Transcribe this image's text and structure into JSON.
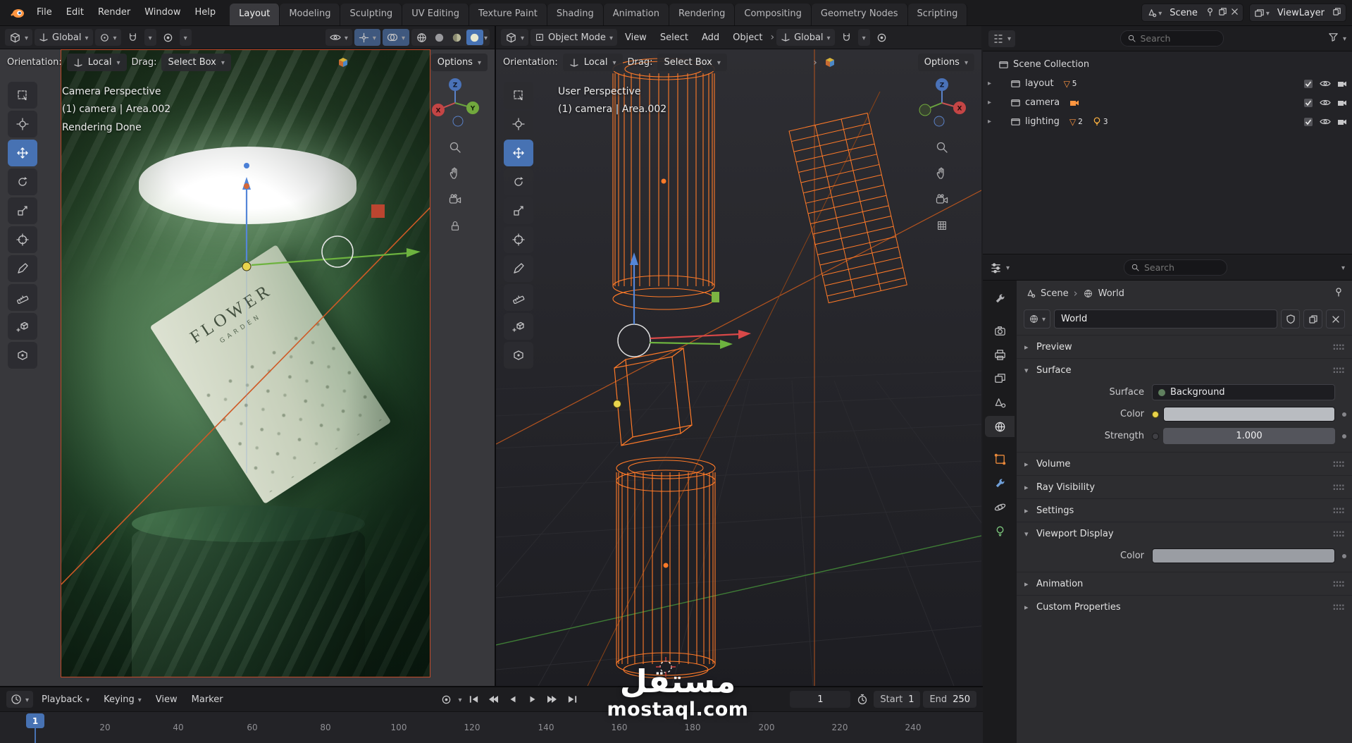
{
  "colors": {
    "accent_blue": "#4772b3",
    "wire_orange": "#ff7a28",
    "render_border": "#c44b2a"
  },
  "topbar": {
    "menus": [
      "File",
      "Edit",
      "Render",
      "Window",
      "Help"
    ],
    "tabs": [
      "Layout",
      "Modeling",
      "Sculpting",
      "UV Editing",
      "Texture Paint",
      "Shading",
      "Animation",
      "Rendering",
      "Compositing",
      "Geometry Nodes",
      "Scripting"
    ],
    "scene_label": "Scene",
    "viewlayer_label": "ViewLayer"
  },
  "vp_left": {
    "transform_orientation": "Global",
    "orientation_label": "Orientation:",
    "orientation_value": "Local",
    "drag_label": "Drag:",
    "drag_value": "Select Box",
    "options_label": "Options",
    "overlay_line1": "Camera Perspective",
    "overlay_line2": "(1) camera | Area.002",
    "overlay_line3": "Rendering Done",
    "box_title": "FLOWER",
    "box_subtitle": "GARDEN"
  },
  "vp_right": {
    "mode": "Object Mode",
    "menu_view": "View",
    "menu_select": "Select",
    "menu_add": "Add",
    "menu_object": "Object",
    "transform_orientation": "Global",
    "orientation_label": "Orientation:",
    "orientation_value": "Local",
    "drag_label": "Drag:",
    "drag_value": "Select Box",
    "options_label": "Options",
    "overlay_line1": "User Perspective",
    "overlay_line2": "(1) camera | Area.002"
  },
  "outliner": {
    "search_placeholder": "Search",
    "root_label": "Scene Collection",
    "items": [
      {
        "label": "layout",
        "badge": "5"
      },
      {
        "label": "camera"
      },
      {
        "label": "lighting",
        "badge": "2",
        "badge2": "3"
      }
    ]
  },
  "properties": {
    "search_placeholder": "Search",
    "breadcrumb_scene": "Scene",
    "breadcrumb_world": "World",
    "datablock_name": "World",
    "panel_preview": "Preview",
    "panel_surface": "Surface",
    "panel_volume": "Volume",
    "panel_ray": "Ray Visibility",
    "panel_settings": "Settings",
    "panel_viewport": "Viewport Display",
    "panel_animation": "Animation",
    "panel_custom": "Custom Properties",
    "surface_label": "Surface",
    "surface_value": "Background",
    "color_label": "Color",
    "strength_label": "Strength",
    "strength_value": "1.000",
    "vd_color_label": "Color"
  },
  "timeline": {
    "menu_playback": "Playback",
    "menu_keying": "Keying",
    "menu_view": "View",
    "menu_marker": "Marker",
    "frame_value": "1",
    "start_label": "Start",
    "start_value": "1",
    "end_label": "End",
    "end_value": "250",
    "ticks": [
      "20",
      "40",
      "60",
      "80",
      "100",
      "120",
      "140",
      "160",
      "180",
      "200",
      "220",
      "240"
    ],
    "playhead": "1"
  },
  "watermark": {
    "line1": "مستقل",
    "line2": "mostaql.com"
  }
}
